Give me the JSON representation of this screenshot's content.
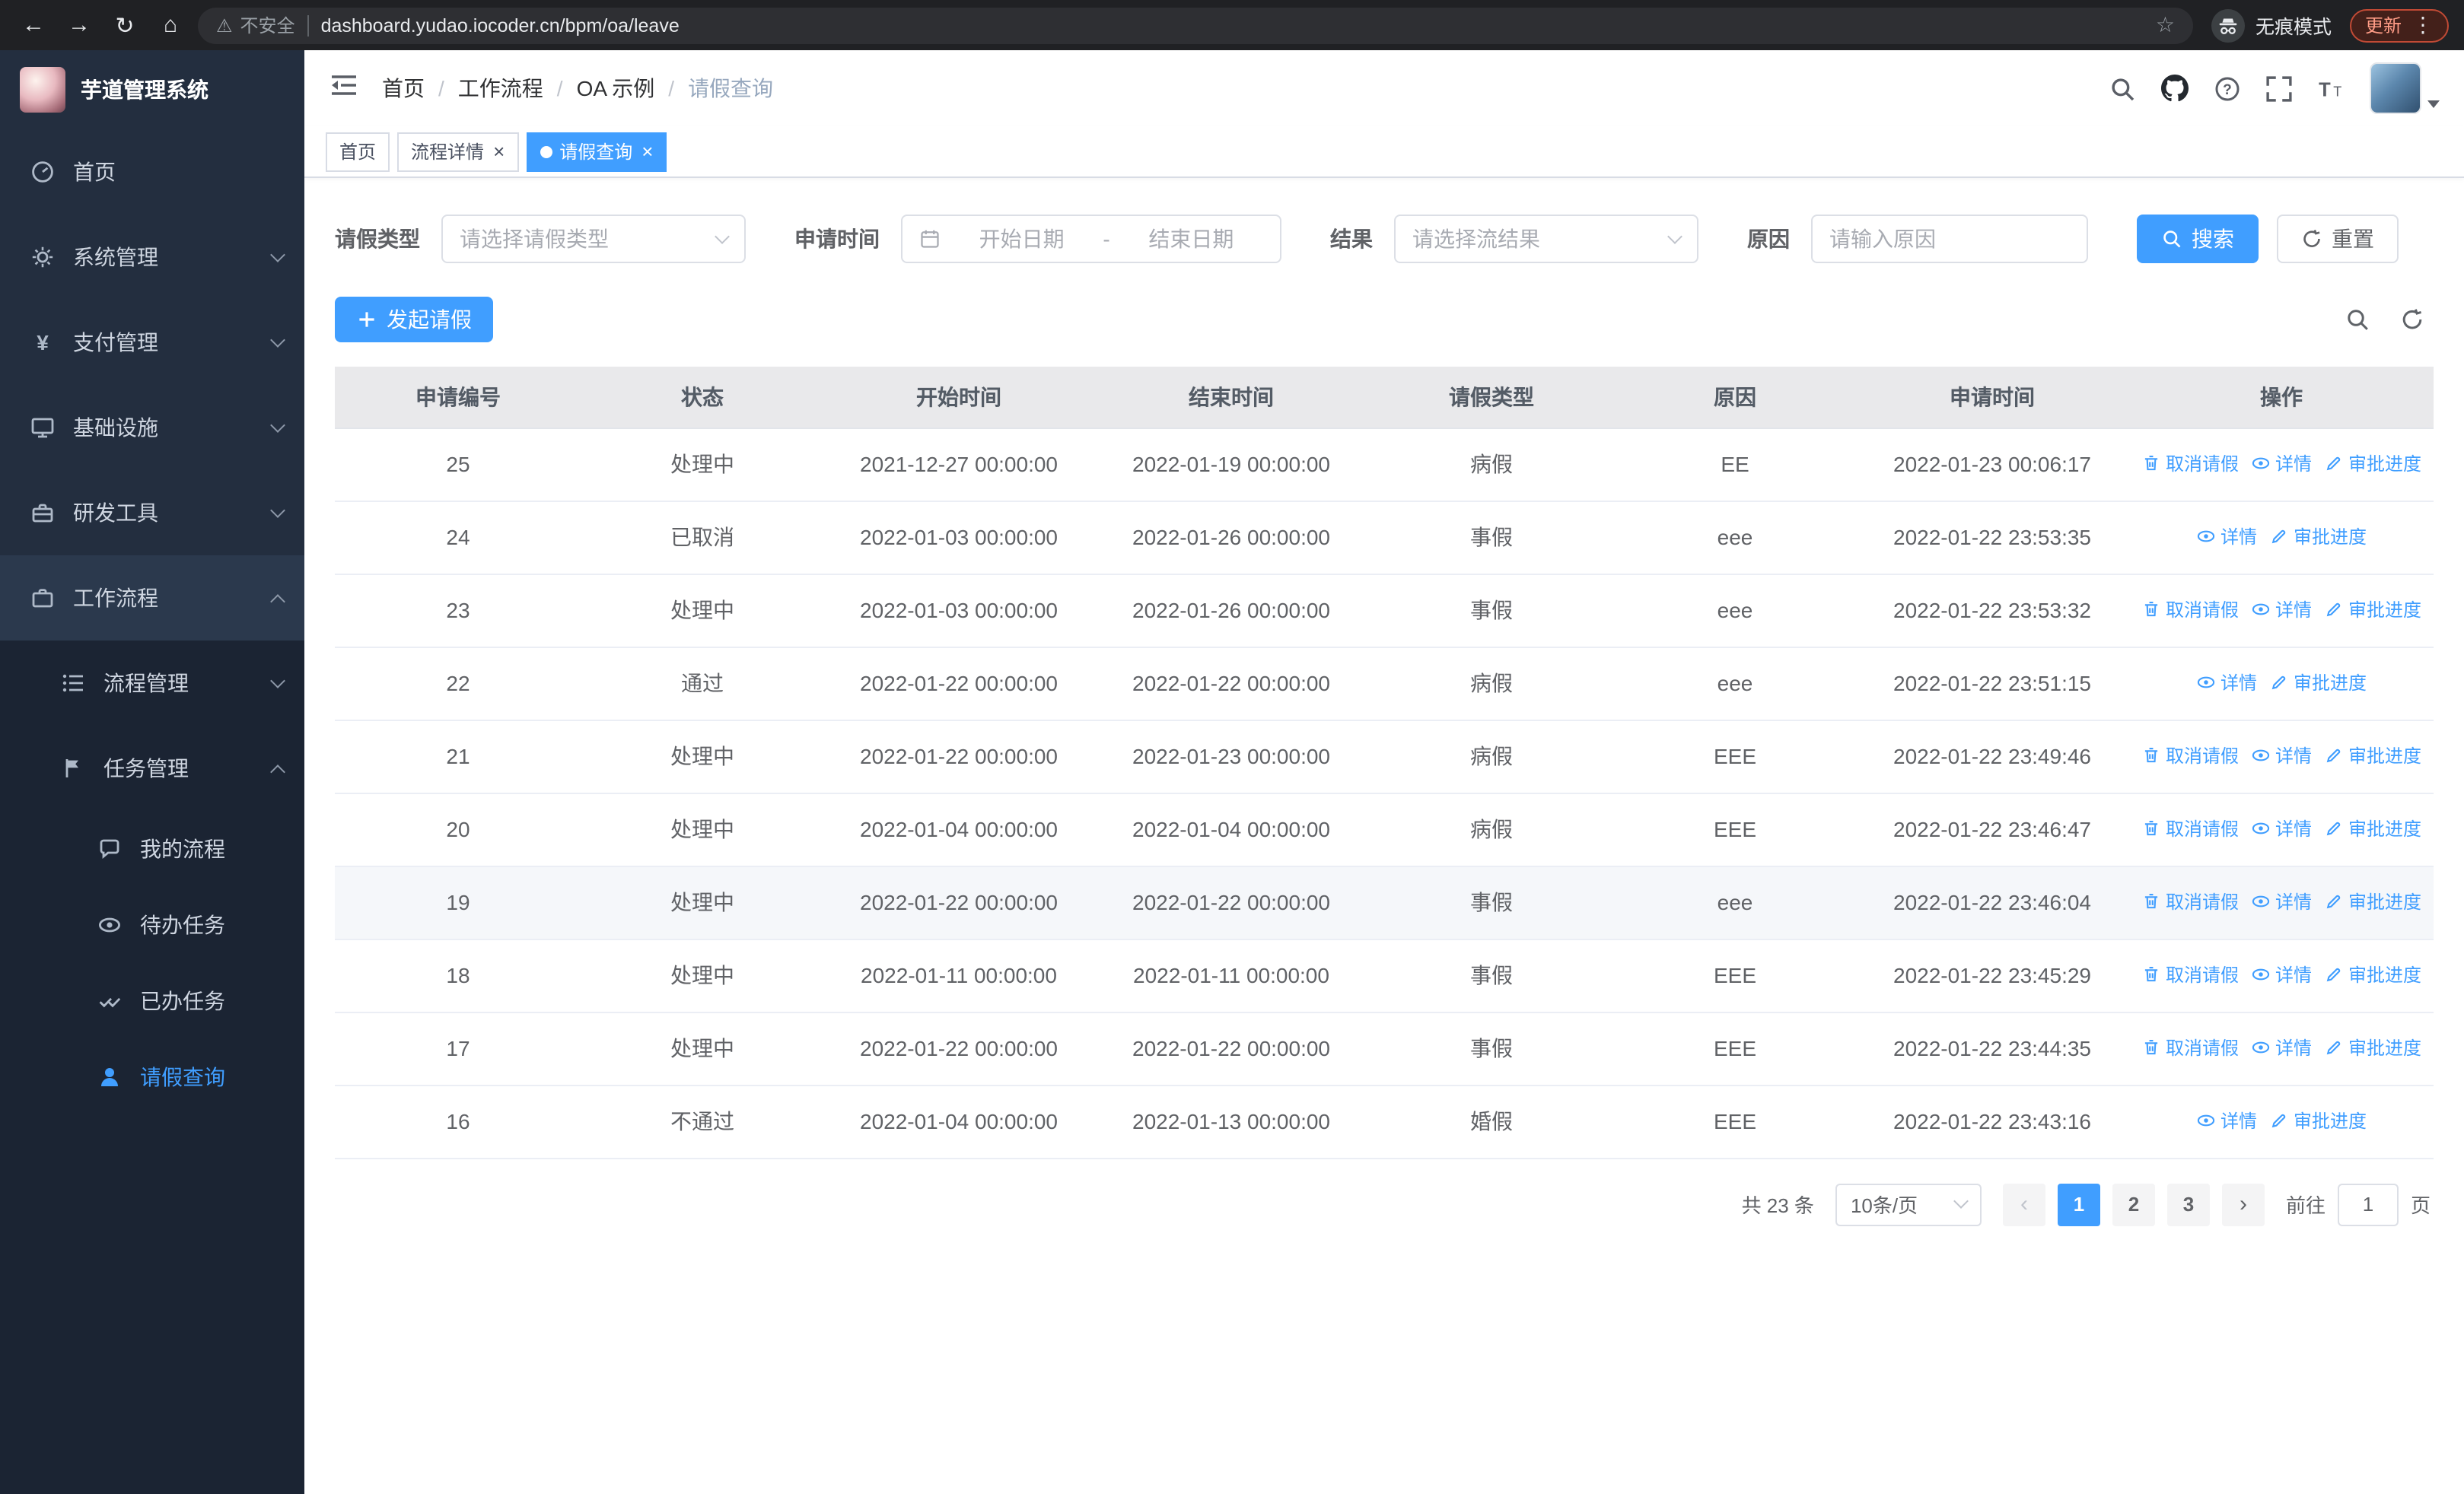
{
  "browser": {
    "security_label": "不安全",
    "url": "dashboard.yudao.iocoder.cn/bpm/oa/leave",
    "incognito_label": "无痕模式",
    "update_label": "更新",
    "icons": {
      "back": "←",
      "forward": "→",
      "reload": "↻",
      "home": "⌂",
      "warning": "⚠",
      "star": "☆",
      "more": "⋮"
    }
  },
  "sidebar": {
    "logo_title": "芋道管理系统",
    "items": [
      {
        "label": "首页"
      },
      {
        "label": "系统管理"
      },
      {
        "label": "支付管理"
      },
      {
        "label": "基础设施"
      },
      {
        "label": "研发工具"
      },
      {
        "label": "工作流程"
      },
      {
        "label": "流程管理"
      },
      {
        "label": "任务管理"
      },
      {
        "label": "我的流程"
      },
      {
        "label": "待办任务"
      },
      {
        "label": "已办任务"
      },
      {
        "label": "请假查询"
      }
    ],
    "yen_glyph": "¥"
  },
  "header": {
    "breadcrumb": [
      "首页",
      "工作流程",
      "OA 示例",
      "请假查询"
    ],
    "separator": "/"
  },
  "tabs": {
    "items": [
      {
        "label": "首页"
      },
      {
        "label": "流程详情"
      },
      {
        "label": "请假查询"
      }
    ],
    "close_glyph": "×"
  },
  "filters": {
    "leave_type_label": "请假类型",
    "leave_type_placeholder": "请选择请假类型",
    "apply_time_label": "申请时间",
    "start_date_placeholder": "开始日期",
    "range_separator": "-",
    "end_date_placeholder": "结束日期",
    "result_label": "结果",
    "result_placeholder": "请选择流结果",
    "reason_label": "原因",
    "reason_placeholder": "请输入原因",
    "search_label": "搜索",
    "reset_label": "重置"
  },
  "toolbar": {
    "create_label": "发起请假"
  },
  "table": {
    "columns": [
      "申请编号",
      "状态",
      "开始时间",
      "结束时间",
      "请假类型",
      "原因",
      "申请时间",
      "操作"
    ],
    "column_keys": [
      "id",
      "status",
      "start",
      "end",
      "type",
      "reason",
      "applied"
    ],
    "action_labels": {
      "cancel": "取消请假",
      "detail": "详情",
      "progress": "审批进度"
    },
    "rows": [
      {
        "id": "25",
        "status": "处理中",
        "start": "2021-12-27 00:00:00",
        "end": "2022-01-19 00:00:00",
        "type": "病假",
        "reason": "EE",
        "applied": "2022-01-23 00:06:17",
        "actions": [
          "cancel",
          "detail",
          "progress"
        ],
        "highlight": false
      },
      {
        "id": "24",
        "status": "已取消",
        "start": "2022-01-03 00:00:00",
        "end": "2022-01-26 00:00:00",
        "type": "事假",
        "reason": "eee",
        "applied": "2022-01-22 23:53:35",
        "actions": [
          "detail",
          "progress"
        ],
        "highlight": false
      },
      {
        "id": "23",
        "status": "处理中",
        "start": "2022-01-03 00:00:00",
        "end": "2022-01-26 00:00:00",
        "type": "事假",
        "reason": "eee",
        "applied": "2022-01-22 23:53:32",
        "actions": [
          "cancel",
          "detail",
          "progress"
        ],
        "highlight": false
      },
      {
        "id": "22",
        "status": "通过",
        "start": "2022-01-22 00:00:00",
        "end": "2022-01-22 00:00:00",
        "type": "病假",
        "reason": "eee",
        "applied": "2022-01-22 23:51:15",
        "actions": [
          "detail",
          "progress"
        ],
        "highlight": false
      },
      {
        "id": "21",
        "status": "处理中",
        "start": "2022-01-22 00:00:00",
        "end": "2022-01-23 00:00:00",
        "type": "病假",
        "reason": "EEE",
        "applied": "2022-01-22 23:49:46",
        "actions": [
          "cancel",
          "detail",
          "progress"
        ],
        "highlight": false
      },
      {
        "id": "20",
        "status": "处理中",
        "start": "2022-01-04 00:00:00",
        "end": "2022-01-04 00:00:00",
        "type": "病假",
        "reason": "EEE",
        "applied": "2022-01-22 23:46:47",
        "actions": [
          "cancel",
          "detail",
          "progress"
        ],
        "highlight": false
      },
      {
        "id": "19",
        "status": "处理中",
        "start": "2022-01-22 00:00:00",
        "end": "2022-01-22 00:00:00",
        "type": "事假",
        "reason": "eee",
        "applied": "2022-01-22 23:46:04",
        "actions": [
          "cancel",
          "detail",
          "progress"
        ],
        "highlight": true
      },
      {
        "id": "18",
        "status": "处理中",
        "start": "2022-01-11 00:00:00",
        "end": "2022-01-11 00:00:00",
        "type": "事假",
        "reason": "EEE",
        "applied": "2022-01-22 23:45:29",
        "actions": [
          "cancel",
          "detail",
          "progress"
        ],
        "highlight": false
      },
      {
        "id": "17",
        "status": "处理中",
        "start": "2022-01-22 00:00:00",
        "end": "2022-01-22 00:00:00",
        "type": "事假",
        "reason": "EEE",
        "applied": "2022-01-22 23:44:35",
        "actions": [
          "cancel",
          "detail",
          "progress"
        ],
        "highlight": false
      },
      {
        "id": "16",
        "status": "不通过",
        "start": "2022-01-04 00:00:00",
        "end": "2022-01-13 00:00:00",
        "type": "婚假",
        "reason": "EEE",
        "applied": "2022-01-22 23:43:16",
        "actions": [
          "detail",
          "progress"
        ],
        "highlight": false
      }
    ]
  },
  "pagination": {
    "total_label": "共 23 条",
    "page_size_label": "10条/页",
    "prev": "‹",
    "next": "›",
    "pages": [
      "1",
      "2",
      "3"
    ],
    "active_page": "1",
    "goto_label": "前往",
    "goto_value": "1",
    "page_unit": "页"
  },
  "colors": {
    "accent": "#409eff",
    "sidebar_bg": "#232e3f",
    "submenu_bg": "#1b2433",
    "header_row_bg": "#e9e9eb"
  }
}
